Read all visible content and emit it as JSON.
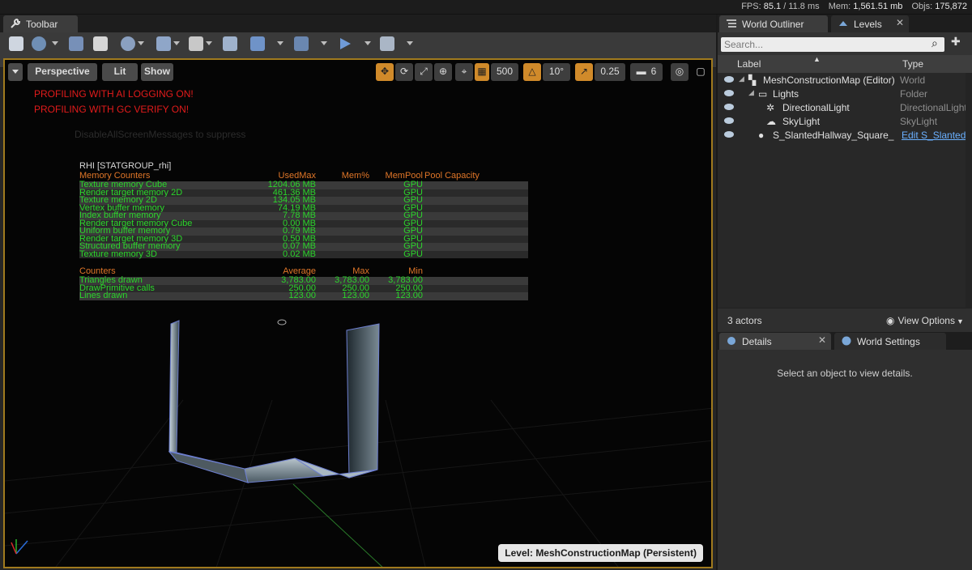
{
  "status": {
    "fps_label": "FPS:",
    "fps_value": "85.1",
    "frame_ms": "/ 11.8 ms",
    "mem_label": "Mem:",
    "mem_value": "1,561.51 mb",
    "objs_label": "Objs:",
    "objs_value": "175,872"
  },
  "left_tab": {
    "label": "Toolbar",
    "icon": "wrench-icon"
  },
  "viewport": {
    "perspective_label": "Perspective",
    "lit_label": "Lit",
    "show_label": "Show",
    "grid_size": "500",
    "rotation_snap": "10°",
    "scale_snap": "0.25",
    "camera_speed": "6",
    "warnings": [
      "PROFILING WITH AI LOGGING ON!",
      "PROFILING WITH GC VERIFY ON!"
    ],
    "ghost_text": "DisableAllScreenMessages to suppress",
    "level_label": "Level:  MeshConstructionMap (Persistent)"
  },
  "stats": {
    "group": "RHI [STATGROUP_rhi]",
    "memory_headers": [
      "Memory Counters",
      "UsedMax",
      "Mem%",
      "MemPool",
      "Pool Capacity"
    ],
    "memory_rows": [
      [
        "Texture memory Cube",
        "1204.06 MB",
        "",
        "GPU"
      ],
      [
        "Render target memory 2D",
        "461.36 MB",
        "",
        "GPU"
      ],
      [
        "Texture memory 2D",
        "134.05 MB",
        "",
        "GPU"
      ],
      [
        "Vertex buffer memory",
        "74.19 MB",
        "",
        "GPU"
      ],
      [
        "Index buffer memory",
        "7.78 MB",
        "",
        "GPU"
      ],
      [
        "Render target memory Cube",
        "0.00 MB",
        "",
        "GPU"
      ],
      [
        "Uniform buffer memory",
        "0.79 MB",
        "",
        "GPU"
      ],
      [
        "Render target memory 3D",
        "0.50 MB",
        "",
        "GPU"
      ],
      [
        "Structured buffer memory",
        "0.07 MB",
        "",
        "GPU"
      ],
      [
        "Texture memory 3D",
        "0.02 MB",
        "",
        "GPU"
      ]
    ],
    "counter_headers": [
      "Counters",
      "Average",
      "Max",
      "Min"
    ],
    "counter_rows": [
      [
        "Triangles drawn",
        "3,783.00",
        "3,783.00",
        "3,783.00"
      ],
      [
        "DrawPrimitive calls",
        "250.00",
        "250.00",
        "250.00"
      ],
      [
        "Lines drawn",
        "123.00",
        "123.00",
        "123.00"
      ]
    ]
  },
  "outliner": {
    "tab_label": "World Outliner",
    "levels_tab_label": "Levels",
    "search_placeholder": "Search...",
    "col_label": "Label",
    "col_type": "Type",
    "items": [
      {
        "label": "MeshConstructionMap (Editor)",
        "type": "World"
      },
      {
        "label": "Lights",
        "type": "Folder"
      },
      {
        "label": "DirectionalLight",
        "type": "DirectionalLight"
      },
      {
        "label": "SkyLight",
        "type": "SkyLight"
      },
      {
        "label": "S_SlantedHallway_Square_",
        "type": "Edit S_SlantedH"
      }
    ],
    "actor_count": "3 actors",
    "view_options": "View Options"
  },
  "details": {
    "tab_label": "Details",
    "world_settings_tab_label": "World Settings",
    "empty_message": "Select an object to view details."
  },
  "colors": {
    "accent": "#d08a2a",
    "warning": "#e21b1b",
    "stat_green": "#2bd52b",
    "stat_orange": "#e07628"
  }
}
